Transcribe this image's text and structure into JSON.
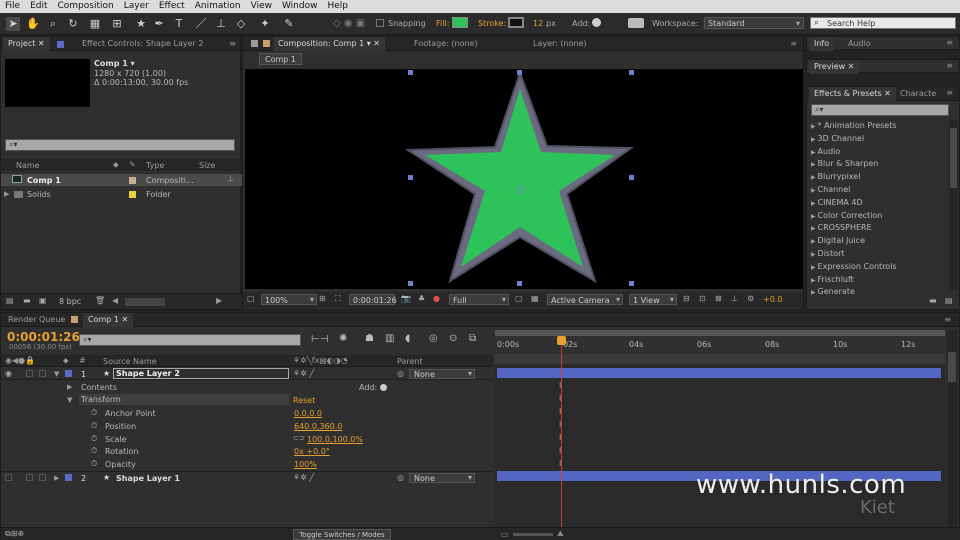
{
  "menu": [
    "File",
    "Edit",
    "Composition",
    "Layer",
    "Effect",
    "Animation",
    "View",
    "Window",
    "Help"
  ],
  "toolbar": {
    "snapping_label": "Snapping",
    "fill_label": "Fill:",
    "fill_color": "#2ec25a",
    "stroke_label": "Stroke:",
    "stroke_width": "12",
    "stroke_unit": "px",
    "add_label": "Add:",
    "workspace_label": "Workspace:",
    "workspace_value": "Standard",
    "search_help": "Search Help"
  },
  "project": {
    "tab_project": "Project",
    "tab_effect_controls": "Effect Controls: Shape Layer 2",
    "comp_name": "Comp 1 ▾",
    "comp_res": "1280 x 720 (1.00)",
    "comp_dur": "Δ 0:00:13:00, 30.00 fps",
    "col_name": "Name",
    "col_type": "Type",
    "col_size": "Size",
    "items": [
      {
        "name": "Comp 1",
        "type": "Compositi...",
        "color": "#c8b090"
      },
      {
        "name": "Solids",
        "type": "Folder",
        "color": "#e8d040"
      }
    ],
    "bpc": "8 bpc"
  },
  "comp_viewer": {
    "tab_comp": "Composition: Comp 1",
    "tab_footage": "Footage: (none)",
    "tab_layer": "Layer: (none)",
    "breadcrumb": "Comp 1",
    "zoom": "100%",
    "timecode": "0:00:01:26",
    "resolution": "Full",
    "camera": "Active Camera",
    "view": "1 View",
    "exposure": "+0.0",
    "star_fill": "#2ec25a",
    "star_stroke": "#6a6a80"
  },
  "right_panels": {
    "info": "Info",
    "audio": "Audio",
    "preview": "Preview",
    "effects_presets": "Effects & Presets",
    "character": "Characte",
    "effects": [
      "* Animation Presets",
      "3D Channel",
      "Audio",
      "Blur & Sharpen",
      "Blurrypixel",
      "Channel",
      "CINEMA 4D",
      "Color Correction",
      "CROSSPHERE",
      "Digital Juice",
      "Distort",
      "Expression Controls",
      "Frischluft",
      "Generate"
    ]
  },
  "timeline": {
    "tab_render": "Render Queue",
    "tab_comp": "Comp 1",
    "timecode": "0:00:01:26",
    "frames": "00056 (30.00 fps)",
    "col_source": "Source Name",
    "col_parent": "Parent",
    "ruler": [
      "0:00s",
      "02s",
      "04s",
      "06s",
      "08s",
      "10s",
      "12s"
    ],
    "layers": [
      {
        "num": "1",
        "name": "Shape Layer 2",
        "parent": "None",
        "color": "#5a68c8"
      },
      {
        "num": "2",
        "name": "Shape Layer 1",
        "parent": "None",
        "color": "#5a68c8"
      }
    ],
    "contents_label": "Contents",
    "add_label": "Add:",
    "transform_label": "Transform",
    "reset_label": "Reset",
    "properties": [
      {
        "name": "Anchor Point",
        "value": "0.0,0.0"
      },
      {
        "name": "Position",
        "value": "640.0,360.0"
      },
      {
        "name": "Scale",
        "value": "100.0,100.0%"
      },
      {
        "name": "Rotation",
        "value": "0x +0.0°"
      },
      {
        "name": "Opacity",
        "value": "100%"
      }
    ],
    "toggle_label": "Toggle Switches / Modes"
  },
  "watermark": {
    "site": "www.hunls.com",
    "brand": "Kiet"
  }
}
